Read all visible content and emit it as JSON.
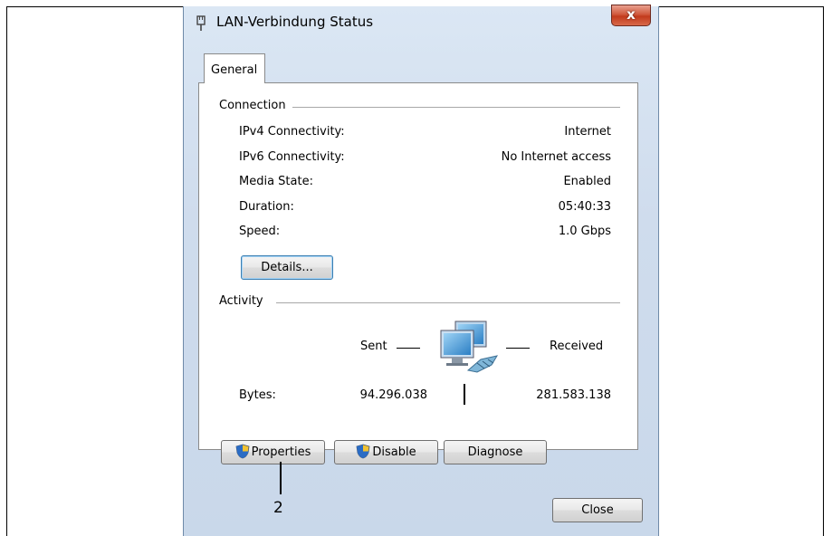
{
  "window": {
    "title": "LAN-Verbindung Status",
    "close_glyph": "x",
    "icon": "network-adapter-icon"
  },
  "tabs": [
    {
      "label": "General",
      "active": true
    }
  ],
  "connection": {
    "title": "Connection",
    "rows": [
      {
        "label": "IPv4 Connectivity:",
        "value": "Internet"
      },
      {
        "label": "IPv6 Connectivity:",
        "value": "No Internet access"
      },
      {
        "label": "Media State:",
        "value": "Enabled"
      },
      {
        "label": "Duration:",
        "value": "05:40:33"
      },
      {
        "label": "Speed:",
        "value": "1.0 Gbps"
      }
    ],
    "details_button": "Details..."
  },
  "activity": {
    "title": "Activity",
    "sent_label": "Sent",
    "received_label": "Received",
    "bytes_label": "Bytes:",
    "bytes_sent": "94.296.038",
    "bytes_received": "281.583.138",
    "icon": "network-computers-icon"
  },
  "buttons": {
    "properties": "Properties",
    "disable": "Disable",
    "diagnose": "Diagnose",
    "close": "Close"
  },
  "callout": {
    "label": "2"
  },
  "colors": {
    "window_frame": "#cfdced",
    "close_button": "#c9462b",
    "focus_border": "#3c7fb1"
  }
}
